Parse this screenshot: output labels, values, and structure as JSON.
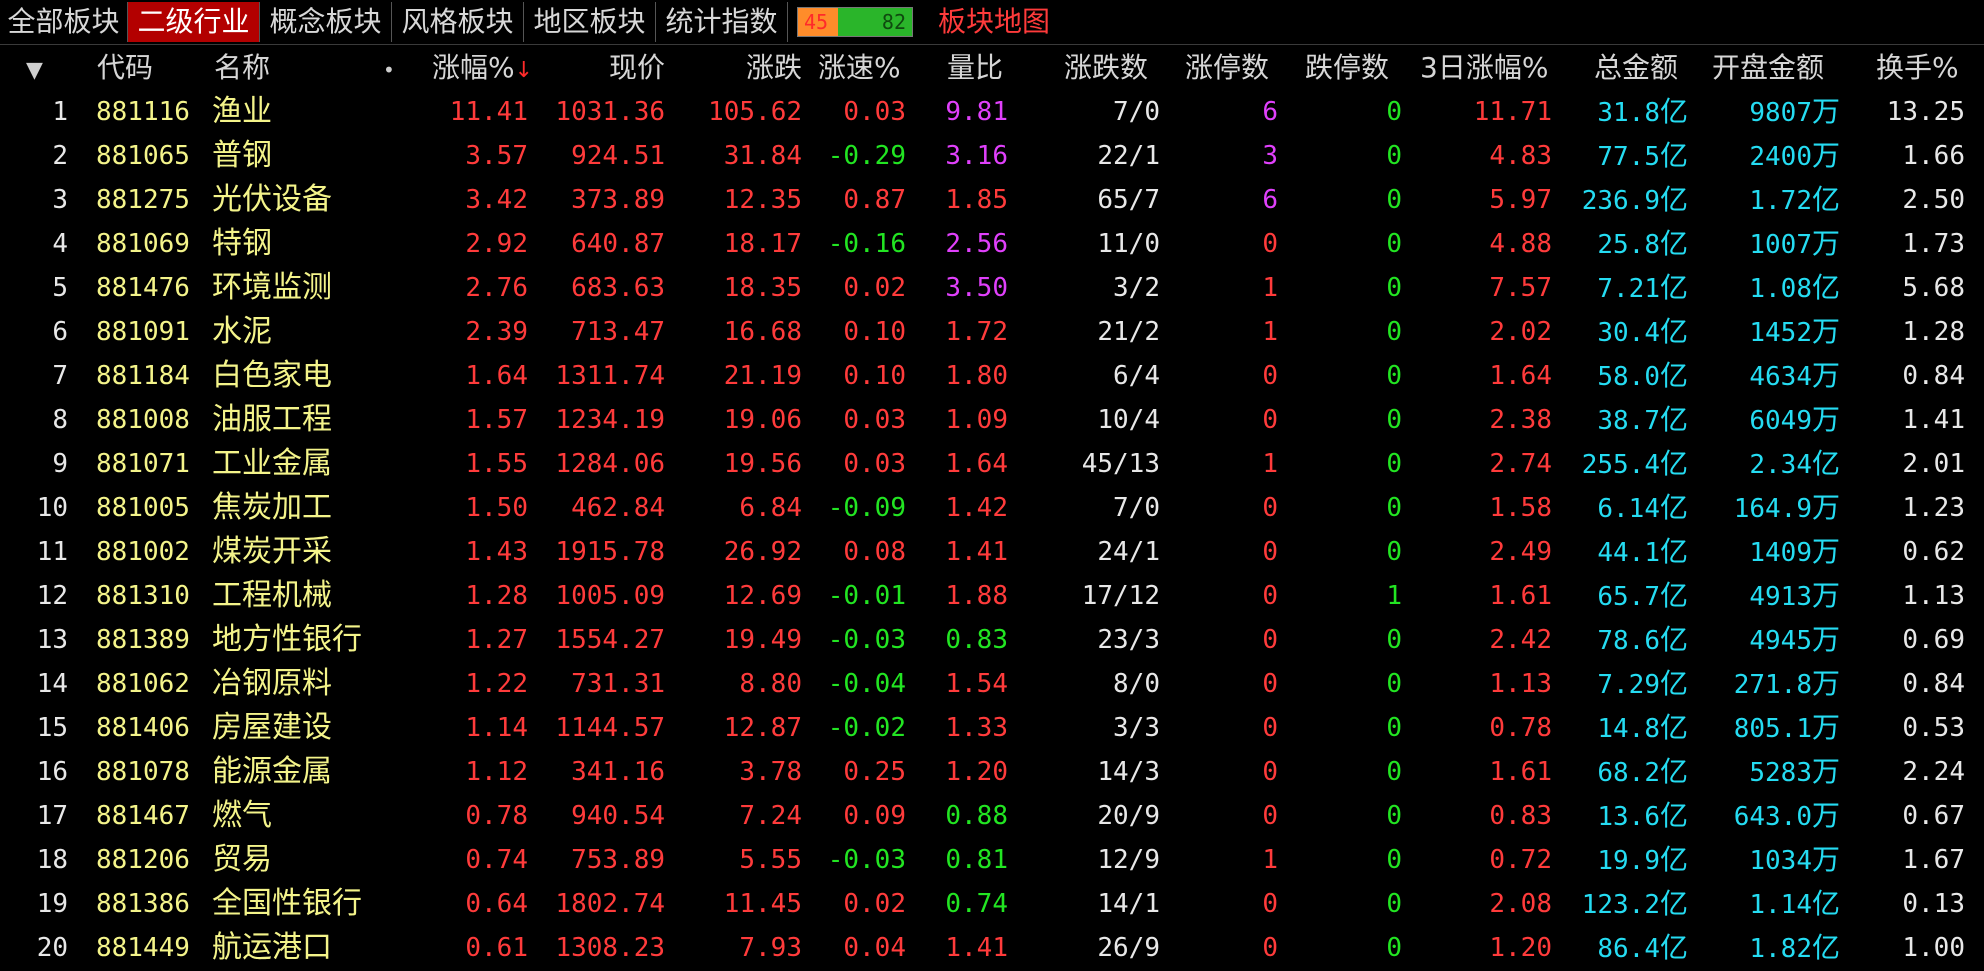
{
  "tabs": [
    {
      "label": "全部板块",
      "active": false
    },
    {
      "label": "二级行业",
      "active": true
    },
    {
      "label": "概念板块",
      "active": false
    },
    {
      "label": "风格板块",
      "active": false
    },
    {
      "label": "地区板块",
      "active": false
    },
    {
      "label": "统计指数",
      "active": false
    }
  ],
  "updown": {
    "up": "45",
    "down": "82",
    "up_fraction": 0.354
  },
  "map_link": "板块地图",
  "columns": {
    "code": "代码",
    "name": "名称",
    "pct": "涨幅%",
    "price": "现价",
    "change": "涨跌",
    "speed": "涨速%",
    "vol_ratio": "量比",
    "updown_count": "涨跌数",
    "limit_up": "涨停数",
    "limit_down": "跌停数",
    "pct3d": "3日涨幅%",
    "amount": "总金额",
    "open_amount": "开盘金额",
    "turnover": "换手%"
  },
  "rows": [
    {
      "idx": "1",
      "code": "881116",
      "name": "渔业",
      "pct": "11.41",
      "price": "1031.36",
      "change": "105.62",
      "speed": "0.03",
      "vol_ratio": "9.81",
      "updown": "7/0",
      "limit_up": "6",
      "limit_down": "0",
      "pct3d": "11.71",
      "amount": "31.8",
      "amount_unit": "亿",
      "open": "9807",
      "open_unit": "万",
      "turnover": "13.25"
    },
    {
      "idx": "2",
      "code": "881065",
      "name": "普钢",
      "pct": "3.57",
      "price": "924.51",
      "change": "31.84",
      "speed": "-0.29",
      "vol_ratio": "3.16",
      "updown": "22/1",
      "limit_up": "3",
      "limit_down": "0",
      "pct3d": "4.83",
      "amount": "77.5",
      "amount_unit": "亿",
      "open": "2400",
      "open_unit": "万",
      "turnover": "1.66"
    },
    {
      "idx": "3",
      "code": "881275",
      "name": "光伏设备",
      "pct": "3.42",
      "price": "373.89",
      "change": "12.35",
      "speed": "0.87",
      "vol_ratio": "1.85",
      "updown": "65/7",
      "limit_up": "6",
      "limit_down": "0",
      "pct3d": "5.97",
      "amount": "236.9",
      "amount_unit": "亿",
      "open": "1.72",
      "open_unit": "亿",
      "turnover": "2.50"
    },
    {
      "idx": "4",
      "code": "881069",
      "name": "特钢",
      "pct": "2.92",
      "price": "640.87",
      "change": "18.17",
      "speed": "-0.16",
      "vol_ratio": "2.56",
      "updown": "11/0",
      "limit_up": "0",
      "limit_down": "0",
      "pct3d": "4.88",
      "amount": "25.8",
      "amount_unit": "亿",
      "open": "1007",
      "open_unit": "万",
      "turnover": "1.73"
    },
    {
      "idx": "5",
      "code": "881476",
      "name": "环境监测",
      "pct": "2.76",
      "price": "683.63",
      "change": "18.35",
      "speed": "0.02",
      "vol_ratio": "3.50",
      "updown": "3/2",
      "limit_up": "1",
      "limit_down": "0",
      "pct3d": "7.57",
      "amount": "7.21",
      "amount_unit": "亿",
      "open": "1.08",
      "open_unit": "亿",
      "turnover": "5.68"
    },
    {
      "idx": "6",
      "code": "881091",
      "name": "水泥",
      "pct": "2.39",
      "price": "713.47",
      "change": "16.68",
      "speed": "0.10",
      "vol_ratio": "1.72",
      "updown": "21/2",
      "limit_up": "1",
      "limit_down": "0",
      "pct3d": "2.02",
      "amount": "30.4",
      "amount_unit": "亿",
      "open": "1452",
      "open_unit": "万",
      "turnover": "1.28"
    },
    {
      "idx": "7",
      "code": "881184",
      "name": "白色家电",
      "pct": "1.64",
      "price": "1311.74",
      "change": "21.19",
      "speed": "0.10",
      "vol_ratio": "1.80",
      "updown": "6/4",
      "limit_up": "0",
      "limit_down": "0",
      "pct3d": "1.64",
      "amount": "58.0",
      "amount_unit": "亿",
      "open": "4634",
      "open_unit": "万",
      "turnover": "0.84"
    },
    {
      "idx": "8",
      "code": "881008",
      "name": "油服工程",
      "pct": "1.57",
      "price": "1234.19",
      "change": "19.06",
      "speed": "0.03",
      "vol_ratio": "1.09",
      "updown": "10/4",
      "limit_up": "0",
      "limit_down": "0",
      "pct3d": "2.38",
      "amount": "38.7",
      "amount_unit": "亿",
      "open": "6049",
      "open_unit": "万",
      "turnover": "1.41"
    },
    {
      "idx": "9",
      "code": "881071",
      "name": "工业金属",
      "pct": "1.55",
      "price": "1284.06",
      "change": "19.56",
      "speed": "0.03",
      "vol_ratio": "1.64",
      "updown": "45/13",
      "limit_up": "1",
      "limit_down": "0",
      "pct3d": "2.74",
      "amount": "255.4",
      "amount_unit": "亿",
      "open": "2.34",
      "open_unit": "亿",
      "turnover": "2.01"
    },
    {
      "idx": "10",
      "code": "881005",
      "name": "焦炭加工",
      "pct": "1.50",
      "price": "462.84",
      "change": "6.84",
      "speed": "-0.09",
      "vol_ratio": "1.42",
      "updown": "7/0",
      "limit_up": "0",
      "limit_down": "0",
      "pct3d": "1.58",
      "amount": "6.14",
      "amount_unit": "亿",
      "open": "164.9",
      "open_unit": "万",
      "turnover": "1.23"
    },
    {
      "idx": "11",
      "code": "881002",
      "name": "煤炭开采",
      "pct": "1.43",
      "price": "1915.78",
      "change": "26.92",
      "speed": "0.08",
      "vol_ratio": "1.41",
      "updown": "24/1",
      "limit_up": "0",
      "limit_down": "0",
      "pct3d": "2.49",
      "amount": "44.1",
      "amount_unit": "亿",
      "open": "1409",
      "open_unit": "万",
      "turnover": "0.62"
    },
    {
      "idx": "12",
      "code": "881310",
      "name": "工程机械",
      "pct": "1.28",
      "price": "1005.09",
      "change": "12.69",
      "speed": "-0.01",
      "vol_ratio": "1.88",
      "updown": "17/12",
      "limit_up": "0",
      "limit_down": "1",
      "pct3d": "1.61",
      "amount": "65.7",
      "amount_unit": "亿",
      "open": "4913",
      "open_unit": "万",
      "turnover": "1.13"
    },
    {
      "idx": "13",
      "code": "881389",
      "name": "地方性银行",
      "pct": "1.27",
      "price": "1554.27",
      "change": "19.49",
      "speed": "-0.03",
      "vol_ratio": "0.83",
      "updown": "23/3",
      "limit_up": "0",
      "limit_down": "0",
      "pct3d": "2.42",
      "amount": "78.6",
      "amount_unit": "亿",
      "open": "4945",
      "open_unit": "万",
      "turnover": "0.69"
    },
    {
      "idx": "14",
      "code": "881062",
      "name": "冶钢原料",
      "pct": "1.22",
      "price": "731.31",
      "change": "8.80",
      "speed": "-0.04",
      "vol_ratio": "1.54",
      "updown": "8/0",
      "limit_up": "0",
      "limit_down": "0",
      "pct3d": "1.13",
      "amount": "7.29",
      "amount_unit": "亿",
      "open": "271.8",
      "open_unit": "万",
      "turnover": "0.84"
    },
    {
      "idx": "15",
      "code": "881406",
      "name": "房屋建设",
      "pct": "1.14",
      "price": "1144.57",
      "change": "12.87",
      "speed": "-0.02",
      "vol_ratio": "1.33",
      "updown": "3/3",
      "limit_up": "0",
      "limit_down": "0",
      "pct3d": "0.78",
      "amount": "14.8",
      "amount_unit": "亿",
      "open": "805.1",
      "open_unit": "万",
      "turnover": "0.53"
    },
    {
      "idx": "16",
      "code": "881078",
      "name": "能源金属",
      "pct": "1.12",
      "price": "341.16",
      "change": "3.78",
      "speed": "0.25",
      "vol_ratio": "1.20",
      "updown": "14/3",
      "limit_up": "0",
      "limit_down": "0",
      "pct3d": "1.61",
      "amount": "68.2",
      "amount_unit": "亿",
      "open": "5283",
      "open_unit": "万",
      "turnover": "2.24"
    },
    {
      "idx": "17",
      "code": "881467",
      "name": "燃气",
      "pct": "0.78",
      "price": "940.54",
      "change": "7.24",
      "speed": "0.09",
      "vol_ratio": "0.88",
      "updown": "20/9",
      "limit_up": "0",
      "limit_down": "0",
      "pct3d": "0.83",
      "amount": "13.6",
      "amount_unit": "亿",
      "open": "643.0",
      "open_unit": "万",
      "turnover": "0.67"
    },
    {
      "idx": "18",
      "code": "881206",
      "name": "贸易",
      "pct": "0.74",
      "price": "753.89",
      "change": "5.55",
      "speed": "-0.03",
      "vol_ratio": "0.81",
      "updown": "12/9",
      "limit_up": "1",
      "limit_down": "0",
      "pct3d": "0.72",
      "amount": "19.9",
      "amount_unit": "亿",
      "open": "1034",
      "open_unit": "万",
      "turnover": "1.67"
    },
    {
      "idx": "19",
      "code": "881386",
      "name": "全国性银行",
      "pct": "0.64",
      "price": "1802.74",
      "change": "11.45",
      "speed": "0.02",
      "vol_ratio": "0.74",
      "updown": "14/1",
      "limit_up": "0",
      "limit_down": "0",
      "pct3d": "2.08",
      "amount": "123.2",
      "amount_unit": "亿",
      "open": "1.14",
      "open_unit": "亿",
      "turnover": "0.13"
    },
    {
      "idx": "20",
      "code": "881449",
      "name": "航运港口",
      "pct": "0.61",
      "price": "1308.23",
      "change": "7.93",
      "speed": "0.04",
      "vol_ratio": "1.41",
      "updown": "26/9",
      "limit_up": "0",
      "limit_down": "0",
      "pct3d": "1.20",
      "amount": "86.4",
      "amount_unit": "亿",
      "open": "1.82",
      "open_unit": "亿",
      "turnover": "1.00"
    }
  ],
  "colors": {
    "up": "#ff3b3b",
    "down": "#22e522",
    "flat": "#e8e8e8",
    "code": "#f4f48a",
    "amount": "#25dcf2",
    "vol_ratio_high": "#e040fb",
    "active_tab": "#b30000"
  },
  "icons": {
    "menu": "caret-down-icon",
    "sort": "sort-desc-arrow-icon",
    "options": "dot-icon"
  }
}
